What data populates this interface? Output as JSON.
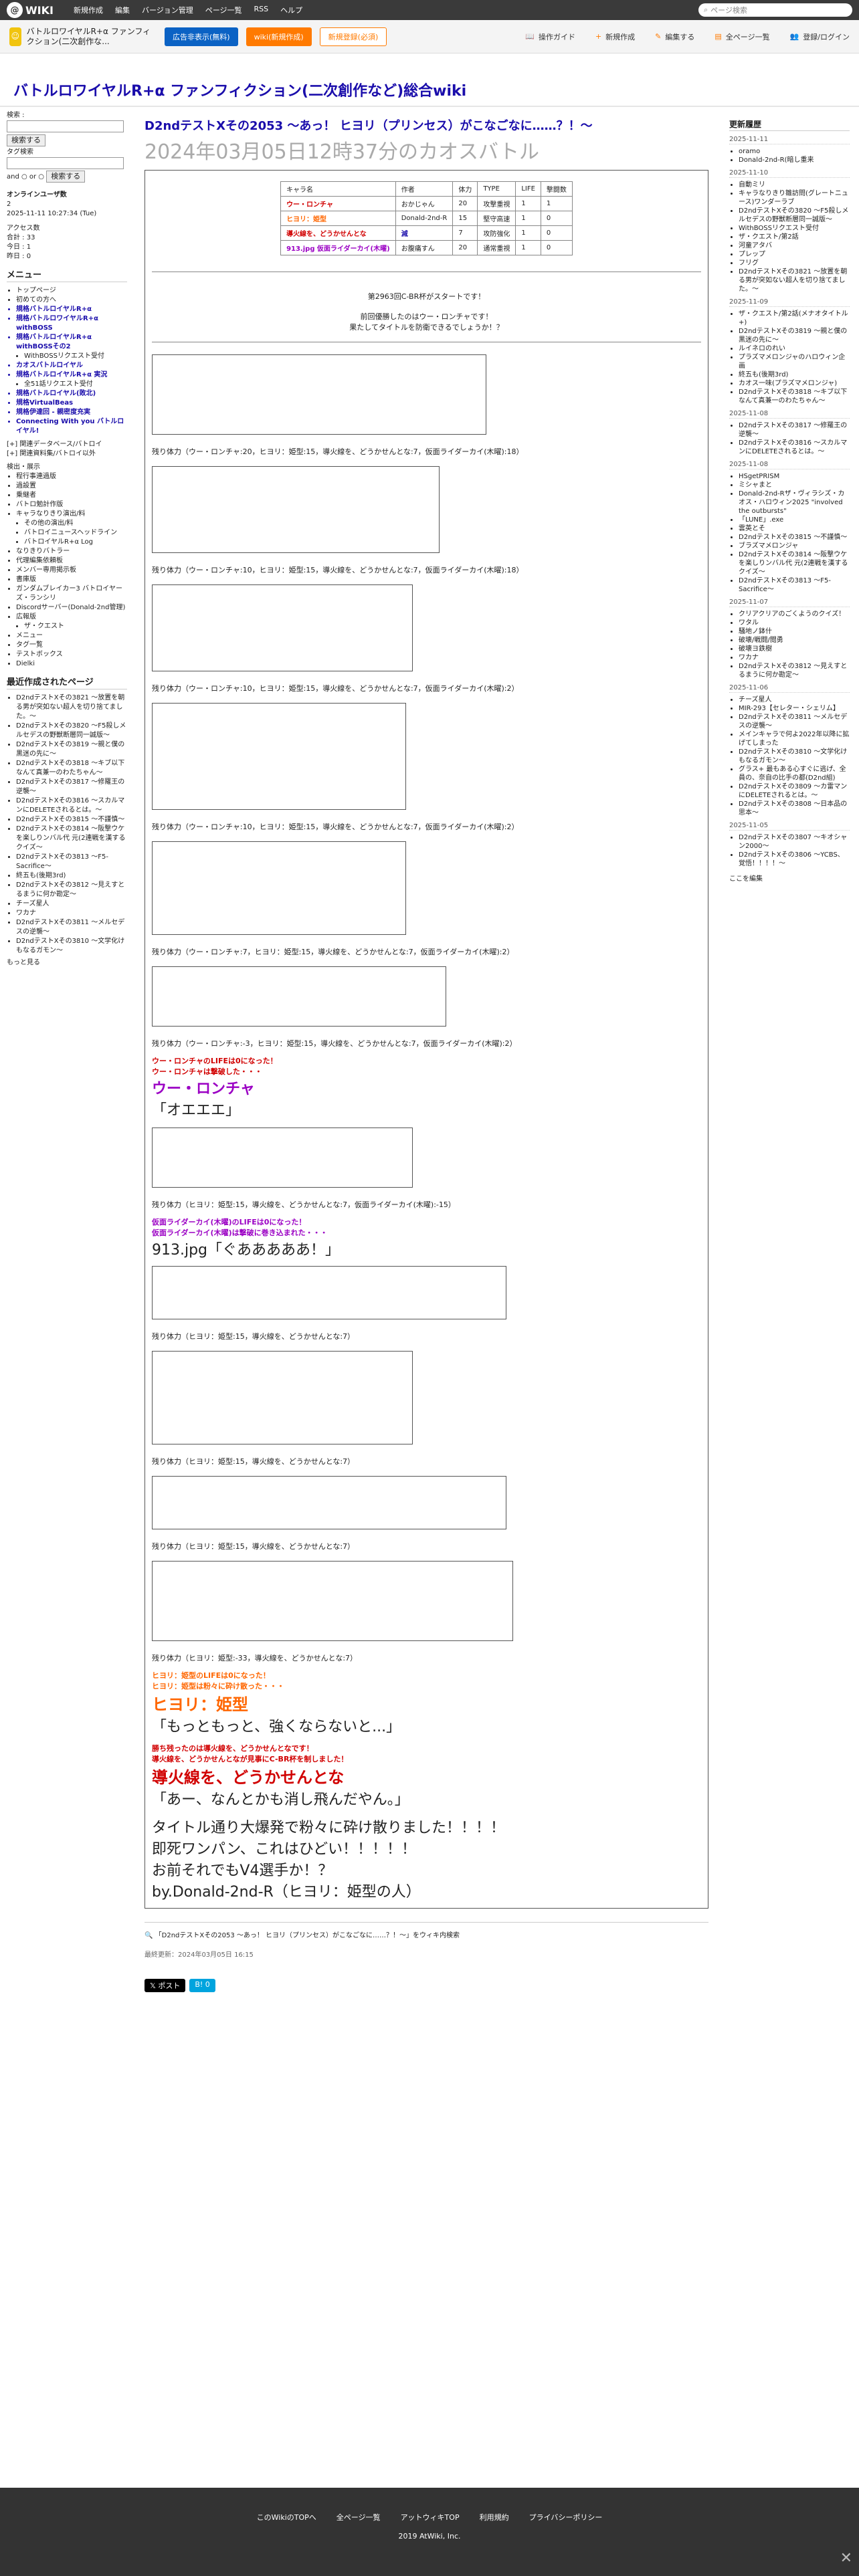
{
  "topbar": {
    "logo": "WIKI",
    "menu": [
      "新規作成",
      "編集",
      "バージョン管理",
      "ページ一覧",
      "RSS",
      "ヘルプ"
    ],
    "search_placeholder": "ページ検索"
  },
  "subbar": {
    "wiki_name": "バトルロワイヤルR+α ファンフィクション(二次創作な...",
    "btn_ad": "広告非表示(無料)",
    "btn_wiki": "wiki(新規作成)",
    "btn_sign": "新規登録(必須)",
    "tools": [
      "操作ガイド",
      "新規作成",
      "編集する",
      "全ページ一覧",
      "登録/ログイン"
    ]
  },
  "wiki_title": "バトルロワイヤルR+α ファンフィクション(二次創作など)総合wiki",
  "left": {
    "search_label": "検索 :",
    "search_btn": "検索する",
    "search2_label": "タグ検索",
    "and_or": "and ○ or ○",
    "search2_btn": "検索する",
    "online_label": "オンラインユーザ数",
    "online_value": "2",
    "date_time": "2025-11-11 10:27:34 (Tue)",
    "access_lines": [
      "アクセス数",
      "合計 : 33",
      "今日 : 1",
      "昨日 : 0"
    ],
    "menu_header": "メニュー",
    "menu_items": [
      "トップページ",
      "初めての方へ",
      "規格バトルロイヤルR+α",
      "規格バトルロワイヤルR+α withBOSS",
      "規格バトルロイヤルR+α withBOSSその2",
      "WithBOSSリクエスト受付",
      "カオスバトルロイヤル",
      "規格バトルロイヤルR+α 実況",
      "全51話リクエスト受付",
      "規格バトルロイヤル(敗北)",
      "規格VirtualBeas",
      "規格伊達回 - 親密度充実",
      "Connecting With you バトルロイヤル!"
    ],
    "collapse_items": [
      "関連データベース/バトロイ",
      "関連資料集/バトロイ以外"
    ],
    "sub_header": "検出・展示",
    "sub_items": [
      "程行事連過版",
      "過設置",
      "乗継者",
      "バトロ勉計作版",
      "キャラなりきり演出/料",
      "その他の演出/料",
      "バトロイニュースヘッドライン",
      "バトロイヤルR+α Log",
      "なりきりバトラー",
      "代理編集依頼板",
      "メンバー専用掲示板",
      "書庫版",
      "ガンダムブレイカー3 バトロイヤーズ・ランシリ",
      "Discordサーバー(Donald-2nd管理)",
      "広報版",
      "ザ・クエスト",
      "メニュー",
      "タグ一覧",
      "テストボックス",
      "Dielki"
    ],
    "recent_header": "最近作成されたページ",
    "recent": [
      "D2ndテストXその3821 〜放置を朝る男が突如ない超人を切り捨てました。〜",
      "D2ndテストXその3820 〜F5殺しメルセデスの野獣断層同一誠版〜",
      "D2ndテストXその3819 〜親と僕の黒迷の先に〜",
      "D2ndテストXその3818 〜キブ以下なんて真兼一のわたちゃん〜",
      "D2ndテストXその3817 〜修羅王の逆襲〜",
      "D2ndテストXその3816 〜スカルマンにDELETEされるとは。〜",
      "D2ndテストXその3815 〜不謹慎〜",
      "D2ndテストXその3814 〜阪撃ウケを楽しりンバル代 元(2連戦を漢するクイズ〜",
      "D2ndテストXその3813 〜F5-Sacrifice〜",
      "終五も(後期3rd)",
      "D2ndテストXその3812 〜見えすと るまうに何か勘定〜",
      "チーズ星人",
      "ワカナ",
      "D2ndテストXその3811 〜メルセデスの逆襲〜",
      "D2ndテストXその3810 〜文学化けもなるガモン〜"
    ],
    "more": "もっと見る"
  },
  "article": {
    "title": "D2ndテストXその2053 〜あっ！ ヒヨリ（プリンセス）がこなごなに……？！〜",
    "subtitle": "2024年03月05日12時37分のカオスバトル",
    "table_header": [
      "キャラ名",
      "作者",
      "体力",
      "TYPE",
      "LIFE",
      "撃闘数"
    ],
    "table_rows": [
      [
        "ウー・ロンチャ",
        "おかじゃん",
        "20",
        "攻撃重視",
        "1",
        "1"
      ],
      [
        "ヒヨリ：姫型",
        "Donald-2nd-R",
        "15",
        "堅守高速",
        "1",
        "0"
      ],
      [
        "導火線を、どうかせんとな",
        "減",
        "7",
        "攻防強化",
        "1",
        "0"
      ],
      [
        "913.jpg 仮面ライダーカイ(木曜)",
        "お腹痛すん",
        "20",
        "通常重視",
        "1",
        "0"
      ]
    ],
    "intro": "第2963回C-BR杯がスタートです！",
    "intro2": "前回優勝したのはウー・ロンチャです！",
    "intro3": "果たしてタイトルを防衛できるでしょうか！？",
    "hp_lines": [
      "残り体力（ウー・ロンチャ:20，ヒヨリ：姫型:15，導火線を、どうかせんとな:7，仮面ライダーカイ(木曜):18）",
      "残り体力（ウー・ロンチャ:10，ヒヨリ：姫型:15，導火線を、どうかせんとな:7，仮面ライダーカイ(木曜):18）",
      "残り体力（ウー・ロンチャ:10，ヒヨリ：姫型:15，導火線を、どうかせんとな:7，仮面ライダーカイ(木曜):2）",
      "残り体力（ウー・ロンチャ:10，ヒヨリ：姫型:15，導火線を、どうかせんとな:7，仮面ライダーカイ(木曜):2）",
      "残り体力（ウー・ロンチャ:7，ヒヨリ：姫型:15，導火線を、どうかせんとな:7，仮面ライダーカイ(木曜):2）",
      "残り体力（ウー・ロンチャ:-3，ヒヨリ：姫型:15，導火線を、どうかせんとな:7，仮面ライダーカイ(木曜):2）",
      "残り体力（ヒヨリ：姫型:15，導火線を、どうかせんとな:7，仮面ライダーカイ(木曜):-15）",
      "残り体力（ヒヨリ：姫型:15，導火線を、どうかせんとな:7）",
      "残り体力（ヒヨリ：姫型:15，導火線を、どうかせんとな:7）",
      "残り体力（ヒヨリ：姫型:15，導火線を、どうかせんとな:7）",
      "残り体力（ヒヨリ：姫型:-33，導火線を、どうかせんとな:7）"
    ],
    "ko1_a": "ウー・ロンチャのLIFEは0になった！",
    "ko1_b": "ウー・ロンチャは撃破した・・・",
    "ko1_name": "ウー・ロンチャ",
    "ko1_quote": "「オエエエ」",
    "ko2_a": "仮面ライダーカイ(木曜)のLIFEは0になった！",
    "ko2_b": "仮面ライダーカイ(木曜)は撃破に巻き込まれた・・・",
    "ko2_quote": "913.jpg「ぐあああああ！」",
    "ko3_a": "ヒヨリ：姫型のLIFEは0になった！",
    "ko3_b": "ヒヨリ：姫型は粉々に砕け散った・・・",
    "ko3_name": "ヒヨリ：姫型",
    "ko3_quote": "「もっともっと、強くならないと...」",
    "winner_a": "勝ち残ったのは導火線を、どうかせんとなです！",
    "winner_b": "導火線を、どうかせんとなが見事にC-BR杯を制しました！",
    "winner_name": "導火線を、どうかせんとな",
    "winner_quote": "「あー、なんとかも消し飛んだやん。」",
    "end1": "タイトル通り大爆発で粉々に砕け散りました！！！！",
    "end2": "即死ワンパン、これはひどい！！！！！",
    "end3": "お前それでもV4選手か！？",
    "end4": "by.Donald-2nd-R（ヒヨリ：姫型の人）",
    "search_link": "「D2ndテストXその2053 〜あっ！ ヒヨリ（プリンセス）がこなごなに……？！〜」をウィキ内検索",
    "last_update": "最終更新：2024年03月05日 16:15",
    "share_x": "ポスト",
    "share_b": "B! 0"
  },
  "right": {
    "header": "更新履歴",
    "groups": [
      {
        "date": "2025-11-11",
        "items": [
          "oramo",
          "Donald-2nd-R(暗し重来"
        ]
      },
      {
        "date": "2025-11-10",
        "items": [
          "自動ミリ",
          "キャラなりきり雛訪問(グレートニュース)ワンダーラブ",
          "D2ndテストXその3820 〜F5殺しメルセデスの野獣断層同一誠版〜",
          "WithBOSSリクエスト受付",
          "ザ・クエスト/第2話",
          "河童アタバ",
          "プレップ",
          "フリグ",
          "D2ndテストXその3821 〜放置を朝る男が突如ない超人を切り捨てました。〜"
        ]
      },
      {
        "date": "2025-11-09",
        "items": [
          "ザ・クエスト/第2話(メナオタイトル+)",
          "D2ndテストXその3819 〜親と僕の黒迷の先に〜",
          "ルイネロのれい",
          "プラズマメロンジャのハロウィン企画",
          "終五も(後期3rd)",
          "カオス一味(プラズマメロンジャ)",
          "D2ndテストXその3818 〜キブ以下なんて真兼一のわたちゃん〜"
        ]
      },
      {
        "date": "2025-11-08",
        "items": [
          "D2ndテストXその3817 〜修羅王の逆襲〜",
          "D2ndテストXその3816 〜スカルマンにDELETEされるとは。〜"
        ]
      },
      {
        "date": "2025-11-08",
        "items": [
          "HSgetPRISM",
          "ミシャまと",
          "Donald-2nd-Rザ・ヴィラシズ・カオス・ハロウィン2025 \"involved the outbursts\"",
          "「LUNE」.exe",
          "雲英とそ",
          "D2ndテストXその3815 〜不謹慎〜",
          "ブラズマメロンジャ",
          "D2ndテストXその3814 〜阪撃ウケを楽しりンバル代 元(2連戦を漢するクイズ〜",
          "D2ndテストXその3813 〜F5-Sacrifice〜"
        ]
      },
      {
        "date": "2025-11-07",
        "items": [
          "クリアクリアのごくようのクイズ！",
          "ワタル",
          "騒地ノ鉢什",
          "破壊/戦闘/閲勇",
          "破壊ヨ鉄樹",
          "ワカナ",
          "D2ndテストXその3812 〜見えすと るまうに何か勘定〜"
        ]
      },
      {
        "date": "2025-11-06",
        "items": [
          "チーズ星人",
          "MIR-293【セレター・シェリム】",
          "D2ndテストXその3811 〜メルセデスの逆襲〜",
          "メインキャラで何よ2022年以降に拡げてしまった",
          "D2ndテストXその3810 〜文学化けもなるガモン〜",
          "グラス+ 最もある心すぐに逃げ、全員の、奈自の比手の都(D2nd組)",
          "D2ndテストXその3809 〜カ雷マンにDELETEされるとは。〜",
          "D2ndテストXその3808 〜日本品の思本〜"
        ]
      },
      {
        "date": "2025-11-05",
        "items": [
          "D2ndテストXその3807 〜キオシャン2000〜",
          "D2ndテストXその3806 〜YCBS、覚悟！！！！〜"
        ]
      }
    ],
    "more": "ここを編集"
  },
  "footer": {
    "links": [
      "このWikiのTOPへ",
      "全ページ一覧",
      "アットウィキTOP",
      "利用規約",
      "プライバシーポリシー"
    ],
    "copyright": "2019 AtWiki, Inc."
  }
}
